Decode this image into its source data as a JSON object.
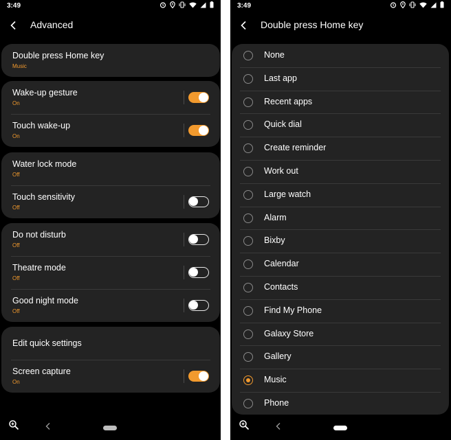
{
  "colors": {
    "accent": "#f29a2e",
    "screen_background": "#000000",
    "card_background": "#232323",
    "text": "#ffffff"
  },
  "left_screen": {
    "status_bar": {
      "time": "3:49",
      "icons": [
        "alarm-icon",
        "location-icon",
        "vibrate-icon",
        "wifi-icon",
        "signal-icon",
        "battery-icon"
      ]
    },
    "header": {
      "back_icon": "chevron-left-icon",
      "title": "Advanced"
    },
    "groups": [
      {
        "rows": [
          {
            "title": "Double press Home key",
            "subtitle": "Music"
          }
        ]
      },
      {
        "rows": [
          {
            "title": "Wake-up gesture",
            "subtitle": "On",
            "toggle": true
          },
          {
            "title": "Touch wake-up",
            "subtitle": "On",
            "toggle": true
          }
        ]
      },
      {
        "rows": [
          {
            "title": "Water lock mode",
            "subtitle": "Off"
          },
          {
            "title": "Touch sensitivity",
            "subtitle": "Off",
            "toggle": false
          }
        ]
      },
      {
        "rows": [
          {
            "title": "Do not disturb",
            "subtitle": "Off",
            "toggle": false
          },
          {
            "title": "Theatre mode",
            "subtitle": "Off",
            "toggle": false
          },
          {
            "title": "Good night mode",
            "subtitle": "Off",
            "toggle": false
          }
        ]
      },
      {
        "rows": [
          {
            "title": "Edit quick settings"
          },
          {
            "title": "Screen capture",
            "subtitle": "On",
            "toggle": true
          }
        ]
      }
    ],
    "nav_bar": {
      "icons": [
        "zoom-icon",
        "back-icon",
        "home-icon"
      ]
    }
  },
  "right_screen": {
    "status_bar": {
      "time": "3:49",
      "icons": [
        "alarm-icon",
        "location-icon",
        "vibrate-icon",
        "wifi-icon",
        "signal-icon",
        "battery-icon"
      ]
    },
    "header": {
      "back_icon": "chevron-left-icon",
      "title": "Double press Home key"
    },
    "options": [
      {
        "label": "None",
        "selected": false
      },
      {
        "label": "Last app",
        "selected": false
      },
      {
        "label": "Recent apps",
        "selected": false
      },
      {
        "label": "Quick dial",
        "selected": false
      },
      {
        "label": "Create reminder",
        "selected": false
      },
      {
        "label": "Work out",
        "selected": false
      },
      {
        "label": "Large watch",
        "selected": false
      },
      {
        "label": "Alarm",
        "selected": false
      },
      {
        "label": "Bixby",
        "selected": false
      },
      {
        "label": "Calendar",
        "selected": false
      },
      {
        "label": "Contacts",
        "selected": false
      },
      {
        "label": "Find My Phone",
        "selected": false
      },
      {
        "label": "Galaxy Store",
        "selected": false
      },
      {
        "label": "Gallery",
        "selected": false
      },
      {
        "label": "Music",
        "selected": true
      },
      {
        "label": "Phone",
        "selected": false
      }
    ],
    "nav_bar": {
      "icons": [
        "zoom-icon",
        "back-icon",
        "home-icon"
      ]
    }
  }
}
